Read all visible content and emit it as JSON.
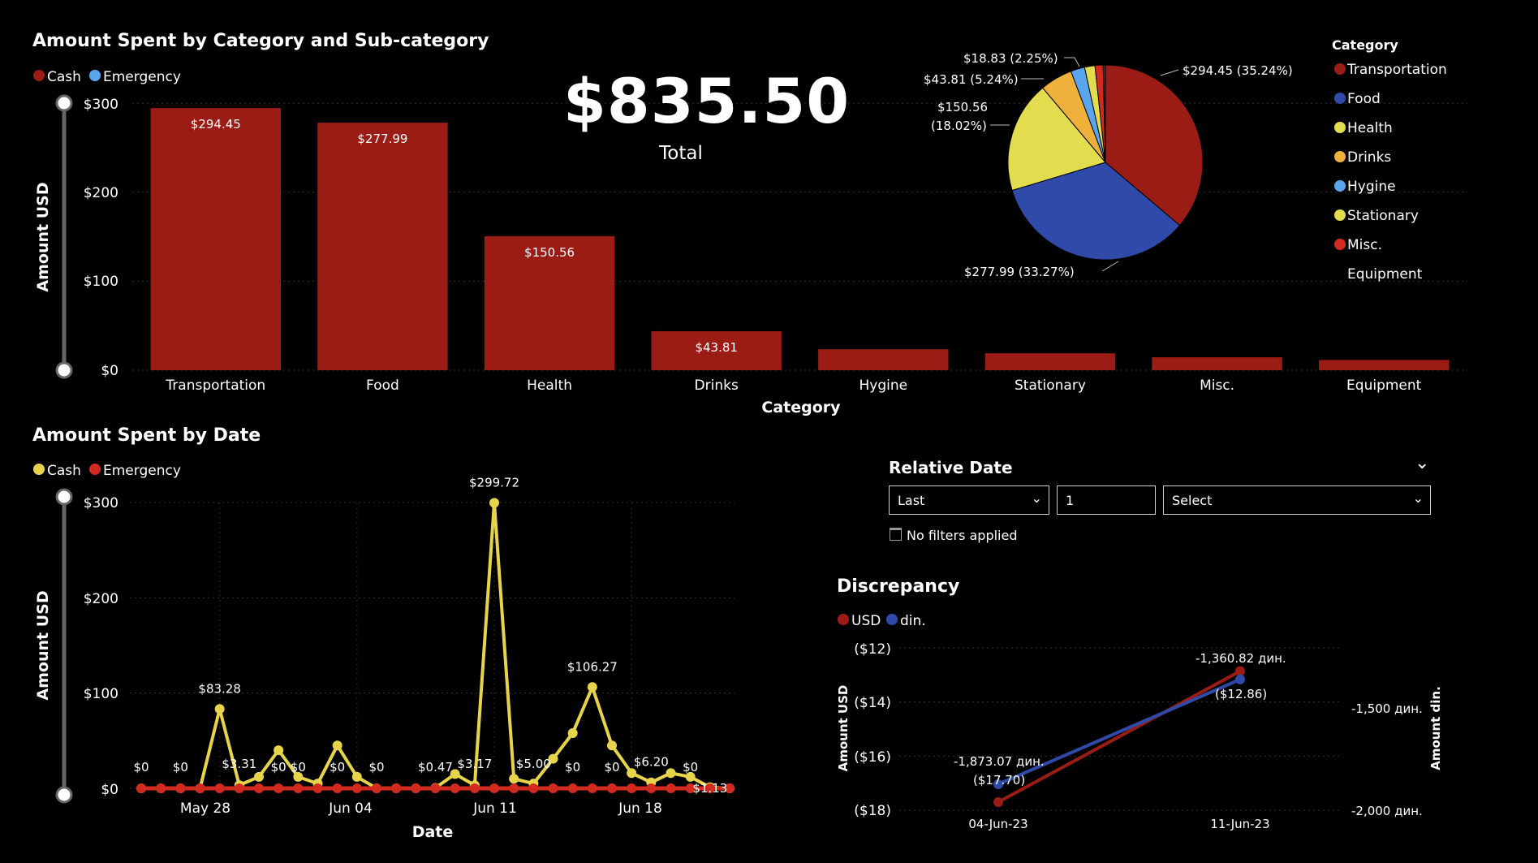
{
  "bar_chart": {
    "title": "Amount Spent by Category and Sub-category",
    "legend": [
      {
        "label": "Cash",
        "color": "#9b1c14"
      },
      {
        "label": "Emergency",
        "color": "#5aa6ee"
      }
    ],
    "ylabel": "Amount USD",
    "xlabel": "Category",
    "yticks": [
      "$300",
      "$200",
      "$100",
      "$0"
    ]
  },
  "total": {
    "value": "$835.50",
    "label": "Total"
  },
  "pie": {
    "legend_title": "Category",
    "legend": [
      {
        "label": "Transportation",
        "color": "#9b1c14"
      },
      {
        "label": "Food",
        "color": "#2f4aa8"
      },
      {
        "label": "Health",
        "color": "#e2dc4e"
      },
      {
        "label": "Drinks",
        "color": "#f0b03c"
      },
      {
        "label": "Hygine",
        "color": "#5aa6ee"
      },
      {
        "label": "Stationary",
        "color": "#e2dc4e"
      },
      {
        "label": "Misc.",
        "color": "#d22a1e"
      },
      {
        "label": "Equipment",
        "color": "#000000"
      }
    ],
    "labels": [
      "$18.83 (2.25%)",
      "$43.81 (5.24%)",
      "$150.56",
      "(18.02%)",
      "$294.45 (35.24%)",
      "$277.99 (33.27%)"
    ]
  },
  "line_chart": {
    "title": "Amount Spent by Date",
    "legend": [
      {
        "label": "Cash",
        "color": "#e8d44a"
      },
      {
        "label": "Emergency",
        "color": "#d22a1e"
      }
    ],
    "ylabel": "Amount USD",
    "xlabel": "Date",
    "yticks": [
      "$300",
      "$200",
      "$100",
      "$0"
    ],
    "xticks": [
      "May 28",
      "Jun 04",
      "Jun 11",
      "Jun 18"
    ],
    "point_labels": [
      "$0",
      "$0",
      "$83.28",
      "$3.31",
      "$0",
      "$0",
      "$0",
      "$0",
      "$0.47",
      "$3.17",
      "$299.72",
      "$5.00",
      "$0",
      "$106.27",
      "$0",
      "$6.20",
      "$0",
      "$1.13"
    ]
  },
  "slicer": {
    "title": "Relative Date",
    "mode": "Last",
    "count": "1",
    "unit_placeholder": "Select",
    "status": "No filters applied"
  },
  "discrepancy": {
    "title": "Discrepancy",
    "legend": [
      {
        "label": "USD",
        "color": "#9b1c14"
      },
      {
        "label": "din.",
        "color": "#2f4aa8"
      }
    ],
    "ylabel_left": "Amount USD",
    "ylabel_right": "Amount din.",
    "yticks_left": [
      "($12)",
      "($14)",
      "($16)",
      "($18)"
    ],
    "yticks_right": [
      "-1,500 дин.",
      "-2,000 дин."
    ],
    "xticks": [
      "04-Jun-23",
      "11-Jun-23"
    ],
    "point_labels": [
      "-1,873.07 дин.",
      "($17.70)",
      "-1,360.82 дин.",
      "($12.86)"
    ]
  },
  "chart_data": [
    {
      "type": "bar",
      "title": "Amount Spent by Category and Sub-category",
      "categories": [
        "Transportation",
        "Food",
        "Health",
        "Drinks",
        "Hygine",
        "Stationary",
        "Misc.",
        "Equipment"
      ],
      "series": [
        {
          "name": "Cash",
          "values": [
            294.45,
            277.99,
            150.56,
            43.81,
            23.5,
            19.0,
            14.5,
            11.5
          ]
        }
      ],
      "data_labels": [
        "$294.45",
        "$277.99",
        "$150.56",
        "$43.81",
        "",
        "",
        "",
        ""
      ],
      "xlabel": "Category",
      "ylabel": "Amount USD",
      "ylim": [
        0,
        300
      ],
      "grid": true
    },
    {
      "type": "pie",
      "categories": [
        "Transportation",
        "Food",
        "Health",
        "Drinks",
        "Hygine",
        "Stationary",
        "Misc.",
        "Equipment"
      ],
      "values": [
        294.45,
        277.99,
        150.56,
        43.81,
        18.83,
        14.0,
        11.0,
        3.0
      ]
    },
    {
      "type": "line",
      "title": "Amount Spent by Date",
      "x": [
        "May 24",
        "May 25",
        "May 26",
        "May 27",
        "May 28",
        "May 29",
        "May 30",
        "May 31",
        "Jun 01",
        "Jun 02",
        "Jun 03",
        "Jun 04",
        "Jun 05",
        "Jun 06",
        "Jun 07",
        "Jun 08",
        "Jun 09",
        "Jun 10",
        "Jun 11",
        "Jun 12",
        "Jun 13",
        "Jun 14",
        "Jun 15",
        "Jun 16",
        "Jun 17",
        "Jun 18",
        "Jun 19",
        "Jun 20",
        "Jun 21",
        "Jun 22",
        "Jun 23"
      ],
      "series": [
        {
          "name": "Cash",
          "values": [
            0,
            0,
            0,
            0,
            83.28,
            3.31,
            12,
            40,
            12,
            5,
            45,
            12,
            0,
            0,
            0,
            0.47,
            15,
            3.17,
            299.72,
            10,
            5,
            31,
            58,
            106.27,
            45,
            16,
            6.2,
            16,
            12,
            1.13,
            0
          ]
        },
        {
          "name": "Emergency",
          "values": [
            0,
            0,
            0,
            0,
            0,
            0,
            0,
            0,
            0,
            0,
            0,
            0,
            0,
            0,
            0,
            0,
            0,
            0,
            0,
            0,
            0,
            0,
            0,
            0,
            0,
            0,
            0,
            0,
            0,
            0,
            0
          ]
        }
      ],
      "xlabel": "Date",
      "ylabel": "Amount USD",
      "ylim": [
        0,
        300
      ],
      "grid": true
    },
    {
      "type": "line",
      "title": "Discrepancy",
      "x": [
        "04-Jun-23",
        "11-Jun-23"
      ],
      "series": [
        {
          "name": "USD",
          "values": [
            -17.7,
            -12.86
          ]
        },
        {
          "name": "din.",
          "values": [
            -1873.07,
            -1360.82
          ]
        }
      ],
      "ylim_left": [
        -18,
        -12
      ],
      "ylim_right": [
        -2000,
        -1300
      ]
    }
  ]
}
